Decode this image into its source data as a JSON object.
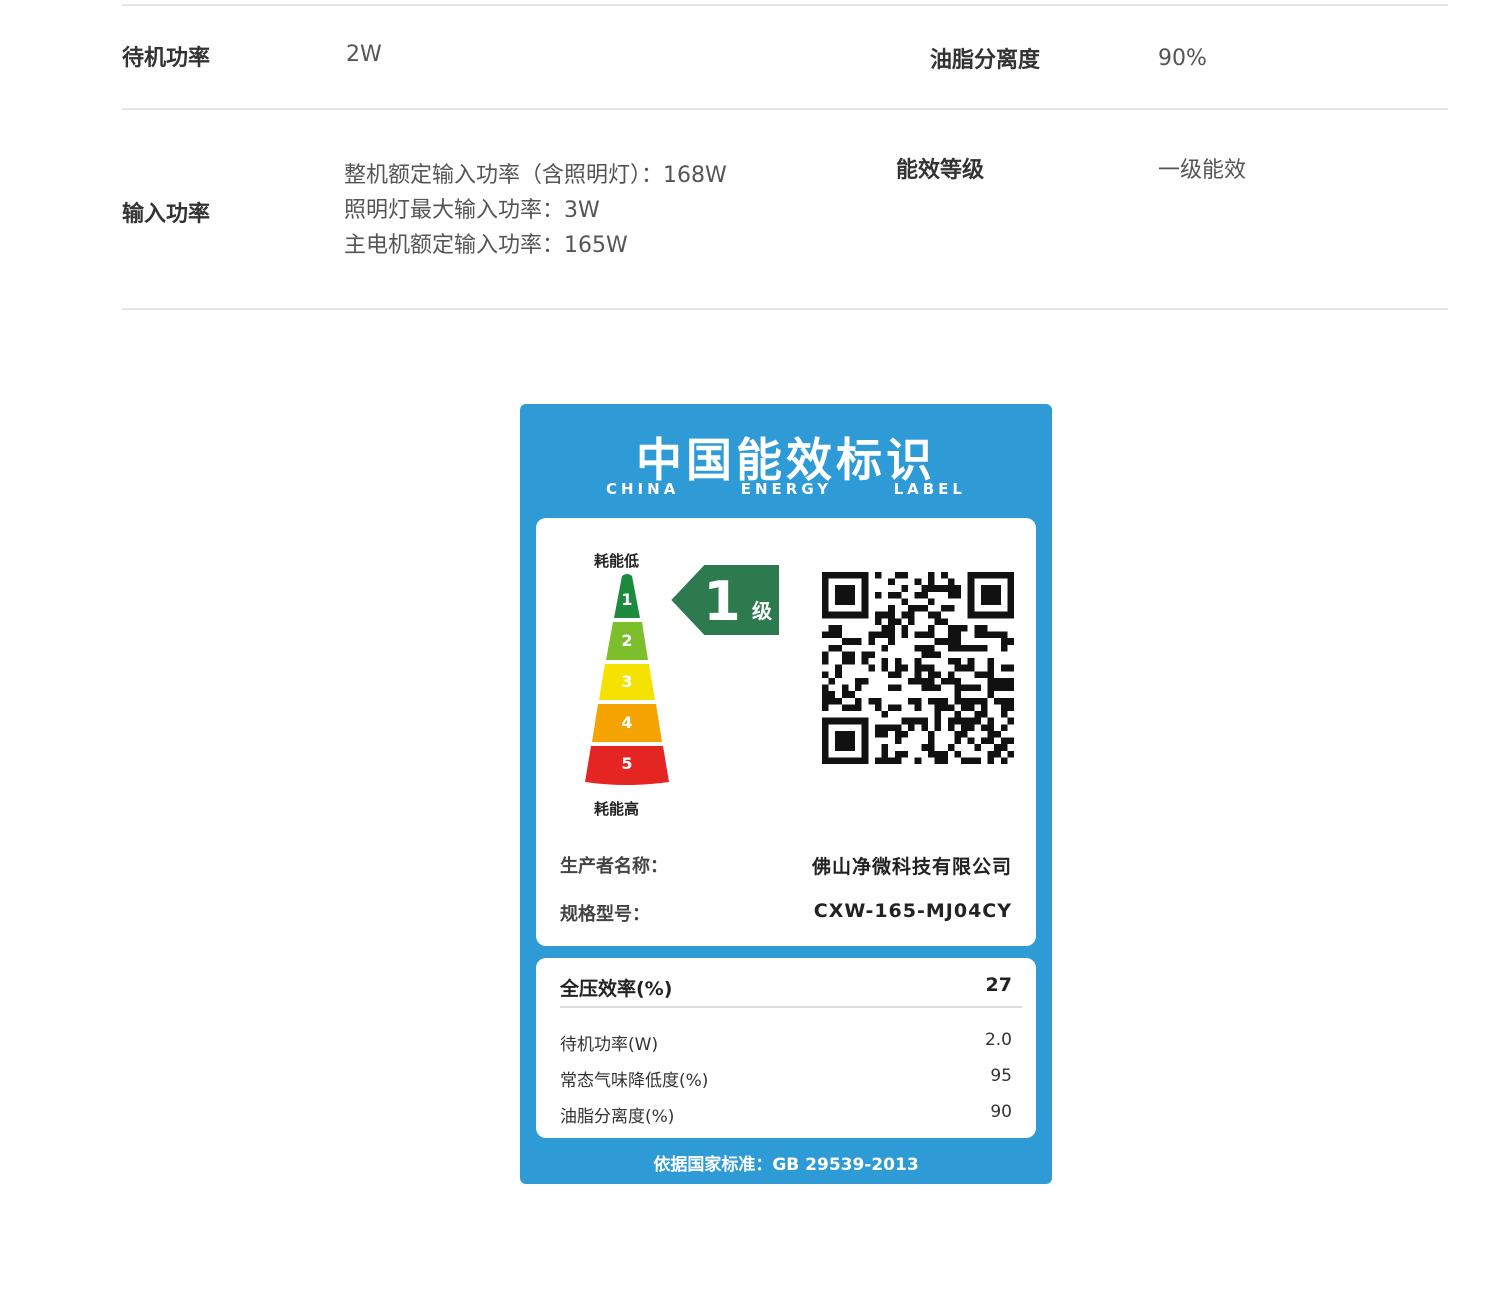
{
  "specs": {
    "row1": {
      "left_label": "待机功率",
      "left_value": "2W",
      "right_label": "油脂分离度",
      "right_value": "90%"
    },
    "row2": {
      "left_label": "输入功率",
      "left_values": [
        "整机额定输入功率（含照明灯）：168W",
        "照明灯最大输入功率：3W",
        "主电机额定输入功率：165W"
      ],
      "right_label": "能效等级",
      "right_value": "一级能效"
    }
  },
  "energy_label": {
    "title": "中国能效标识",
    "subtitle": [
      "CHINA",
      "ENERGY",
      "LABEL"
    ],
    "scale_top": "耗能低",
    "scale_bottom": "耗能高",
    "grades": [
      "1",
      "2",
      "3",
      "4",
      "5"
    ],
    "grade_colors": [
      "#1e8a3e",
      "#7cbf2a",
      "#f5e200",
      "#f5a300",
      "#e52522"
    ],
    "current_grade": "1",
    "grade_unit": "级",
    "manufacturer_label": "生产者名称：",
    "manufacturer_value": "佛山净微科技有限公司",
    "model_label": "规格型号：",
    "model_value": "CXW-165-MJ04CY",
    "main_metric": {
      "label": "全压效率(%)",
      "value": "27"
    },
    "metrics": [
      {
        "label": "待机功率(W)",
        "value": "2.0"
      },
      {
        "label": "常态气味降低度(%)",
        "value": "95"
      },
      {
        "label": "油脂分离度(%)",
        "value": "90"
      }
    ],
    "standard": "依据国家标准：GB 29539-2013",
    "colors": {
      "blue": "#2e9bd6",
      "tag_green": "#2d7a4e"
    }
  }
}
